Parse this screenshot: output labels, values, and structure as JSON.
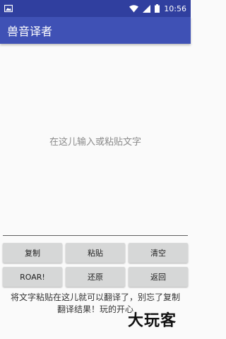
{
  "status_bar": {
    "time": "10:56",
    "icons": [
      "image-icon",
      "wifi-icon",
      "cellular-icon",
      "battery-icon"
    ]
  },
  "app_bar": {
    "title": "兽音译者"
  },
  "input": {
    "placeholder": "在这儿输入或粘贴文字"
  },
  "buttons": {
    "copy": "复制",
    "paste": "粘贴",
    "clear": "清空",
    "roar": "ROAR!",
    "restore": "还原",
    "back": "返回"
  },
  "hint": {
    "line1": "将文字粘贴在这儿就可以翻译了，别忘了复制",
    "line2": "翻译结果！玩的开心"
  },
  "watermark": "大玩客",
  "colors": {
    "primary": "#3f51b5",
    "primary_dark": "#303f9f",
    "button": "#d6d7d7"
  }
}
